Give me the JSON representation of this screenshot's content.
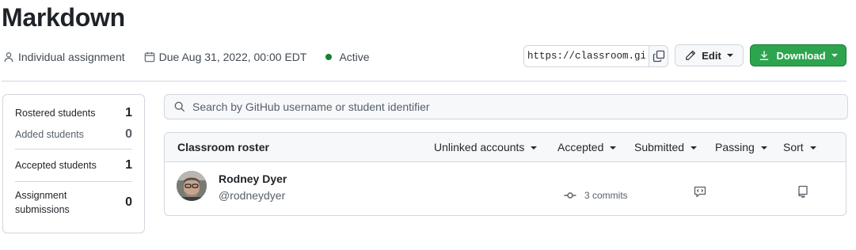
{
  "page": {
    "title": "Markdown"
  },
  "meta": {
    "type_label": "Individual assignment",
    "due_label": "Due Aug 31, 2022, 00:00 EDT",
    "status_label": "Active"
  },
  "invite": {
    "url": "https://classroom.github.com/a/"
  },
  "actions": {
    "edit_label": "Edit",
    "download_label": "Download"
  },
  "stats": {
    "rostered_label": "Rostered students",
    "rostered_value": "1",
    "added_label": "Added students",
    "added_value": "0",
    "accepted_label": "Accepted students",
    "accepted_value": "1",
    "submissions_label": "Assignment submissions",
    "submissions_value": "0"
  },
  "search": {
    "placeholder": "Search by GitHub username or student identifier"
  },
  "roster": {
    "title": "Classroom roster",
    "filters": {
      "unlinked": "Unlinked accounts",
      "accepted": "Accepted",
      "submitted": "Submitted",
      "passing": "Passing",
      "sort": "Sort"
    },
    "students": [
      {
        "name": "Rodney Dyer",
        "handle": "@rodneydyer",
        "commits": "3 commits"
      }
    ]
  },
  "colors": {
    "primary_button": "#2da44e",
    "active_status": "#1a7f37",
    "border": "#d0d7de",
    "subtle_bg": "#f6f8fa"
  },
  "icons": {
    "type": "person-icon",
    "due": "calendar-icon",
    "copy": "copy-icon",
    "edit": "pencil-icon",
    "download": "download-icon",
    "search": "search-icon",
    "commits": "git-commit-icon",
    "feedback": "code-review-icon",
    "repo": "repo-icon"
  }
}
